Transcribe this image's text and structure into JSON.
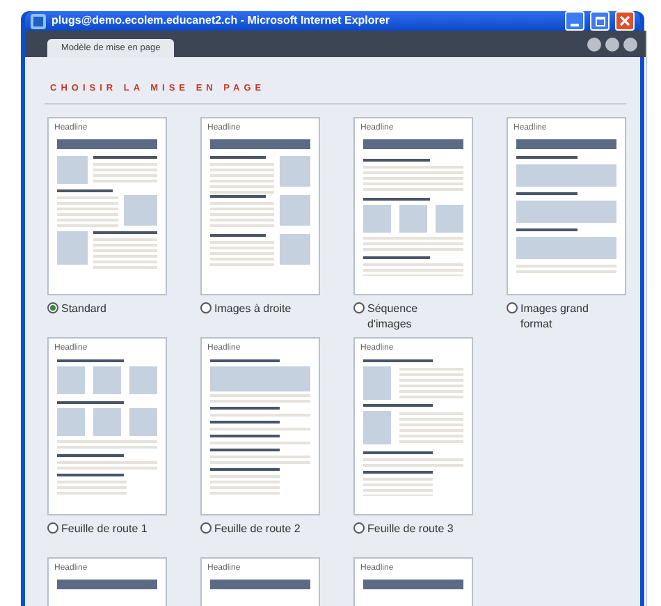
{
  "window": {
    "title": "plugs@demo.ecolem.educanet2.ch - Microsoft Internet Explorer"
  },
  "tab": {
    "label": "Modèle de mise en page"
  },
  "heading": "CHOISIR LA MISE EN PAGE",
  "layouts": [
    {
      "kind": "standard",
      "headline": "Headline",
      "label": "Standard",
      "selected": true
    },
    {
      "kind": "right-images",
      "headline": "Headline",
      "label": "Images à droite",
      "selected": false
    },
    {
      "kind": "sequence",
      "headline": "Headline",
      "label": "Séquence d'images",
      "selected": false
    },
    {
      "kind": "large",
      "headline": "Headline",
      "label": "Images grand format",
      "selected": false
    },
    {
      "kind": "roadmap1",
      "headline": "Headline",
      "label": "Feuille de route 1",
      "selected": false
    },
    {
      "kind": "roadmap2",
      "headline": "Headline",
      "label": "Feuille de route 2",
      "selected": false
    },
    {
      "kind": "roadmap3",
      "headline": "Headline",
      "label": "Feuille de route 3",
      "selected": false
    }
  ],
  "partial_layouts": [
    {
      "headline": "Headline"
    },
    {
      "headline": "Headline"
    },
    {
      "headline": "Headline"
    }
  ]
}
